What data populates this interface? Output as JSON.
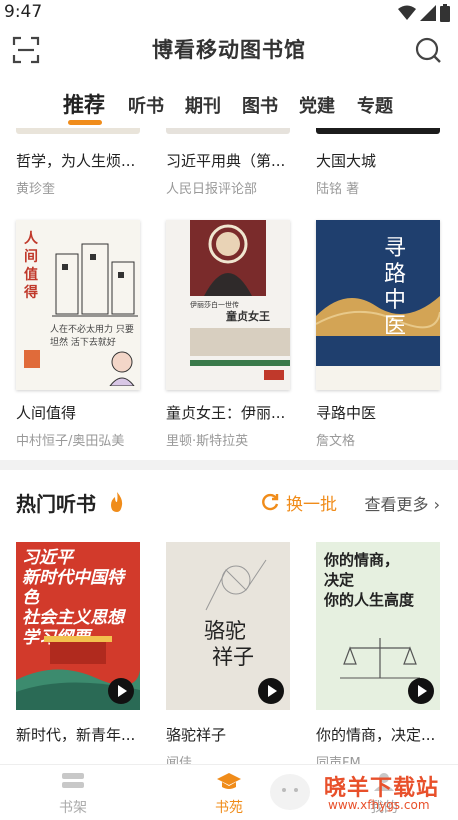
{
  "status": {
    "time": "9:47"
  },
  "header": {
    "title": "博看移动图书馆"
  },
  "tabs": [
    {
      "label": "推荐"
    },
    {
      "label": "听书"
    },
    {
      "label": "期刊"
    },
    {
      "label": "图书"
    },
    {
      "label": "党建"
    },
    {
      "label": "专题"
    }
  ],
  "books_row1": [
    {
      "title": "哲学，为人生烦...",
      "author": "黄珍奎"
    },
    {
      "title": "习近平用典（第...",
      "author": "人民日报评论部"
    },
    {
      "title": "大国大城",
      "author": "陆铭 著"
    }
  ],
  "books_row2": [
    {
      "title": "人间值得",
      "author": "中村恒子/奥田弘美",
      "cover_text": "人间值得",
      "cover_sub": "人在不必太用力 只要坦然 活下去就好"
    },
    {
      "title": "童贞女王：伊丽...",
      "author": "里顿·斯特拉英",
      "cover_text": "童贞女王",
      "cover_sub": "伊丽莎白一世传"
    },
    {
      "title": "寻路中医",
      "author": "詹文格",
      "cover_text": "寻路中医"
    }
  ],
  "audio_section": {
    "title": "热门听书",
    "refresh_label": "换一批",
    "more_label": "查看更多",
    "items": [
      {
        "title": "新时代，新青年...",
        "author": "",
        "cover_lines": [
          "习近平",
          "新时代中国特色",
          "社会主义思想",
          "学习纲要"
        ]
      },
      {
        "title": "骆驼祥子",
        "author": "闻佳",
        "cover_lines": [
          "骆驼",
          "祥子"
        ]
      },
      {
        "title": "你的情商，决定...",
        "author": "同声FM",
        "cover_lines": [
          "你的情商，",
          "决定",
          "你的人生高度"
        ]
      }
    ]
  },
  "bottom_nav": [
    {
      "label": "书架"
    },
    {
      "label": "书苑"
    },
    {
      "label": "我的"
    }
  ],
  "watermark": {
    "title": "晓羊下载站",
    "url": "www.xfhygs.com"
  },
  "colors": {
    "accent": "#f08c1a",
    "watermark": "#e8502b"
  }
}
